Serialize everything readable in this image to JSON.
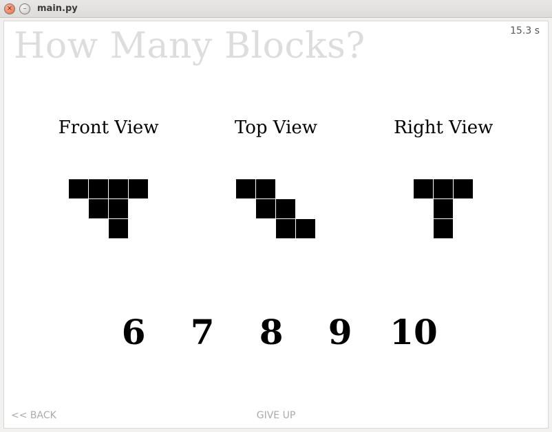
{
  "window": {
    "title": "main.py"
  },
  "game": {
    "heading": "How Many Blocks?",
    "timer": "15.3 s",
    "views": [
      {
        "title": "Front View",
        "cols": 4,
        "grid": [
          [
            1,
            1,
            1,
            1
          ],
          [
            0,
            1,
            1,
            0
          ],
          [
            0,
            0,
            1,
            0
          ]
        ]
      },
      {
        "title": "Top View",
        "cols": 4,
        "grid": [
          [
            1,
            1,
            0,
            0
          ],
          [
            0,
            1,
            1,
            0
          ],
          [
            0,
            0,
            1,
            1
          ]
        ]
      },
      {
        "title": "Right View",
        "cols": 3,
        "grid": [
          [
            1,
            1,
            1
          ],
          [
            0,
            1,
            0
          ],
          [
            0,
            1,
            0
          ]
        ]
      }
    ],
    "answers": [
      "6",
      "7",
      "8",
      "9",
      "10"
    ],
    "back_label": "<< BACK",
    "giveup_label": "GIVE UP"
  }
}
